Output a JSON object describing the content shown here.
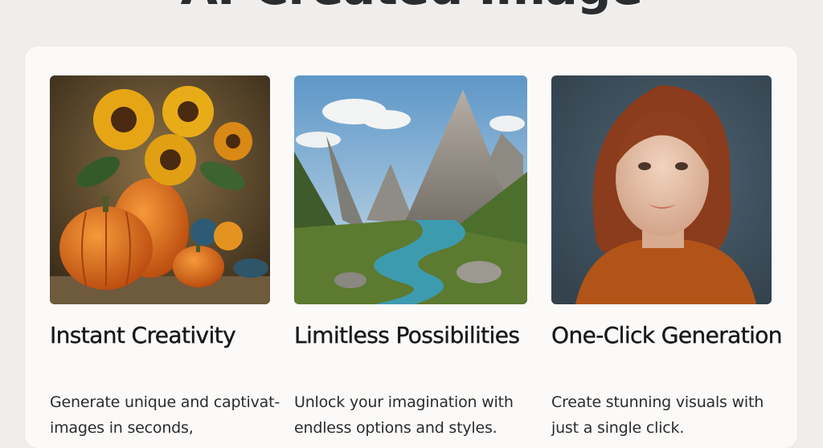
{
  "page": {
    "title": "AI-Created Image"
  },
  "features": [
    {
      "image_subject": "sunflowers-and-pumpkins-painting",
      "title": "Instant Creativity",
      "description": "Generate unique and captivat- images in seconds,"
    },
    {
      "image_subject": "mountain-river-landscape",
      "title": "Limitless Possibilities",
      "description": "Unlock your imagination with endless options and styles."
    },
    {
      "image_subject": "woman-portrait",
      "title": "One-Click Generation",
      "description": "Create stunning visuals with just a single click."
    }
  ]
}
